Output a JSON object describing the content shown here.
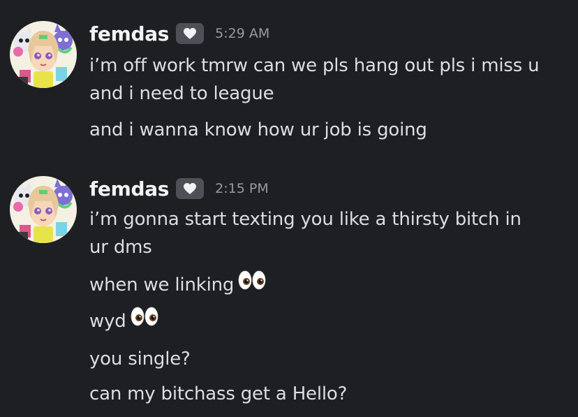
{
  "messages": [
    {
      "username": "femdas",
      "timestamp": "5:29 AM",
      "lines": [
        "i’m off work tmrw can we pls hang out pls i miss u",
        "and i need to league",
        "and i wanna know how ur job is going"
      ]
    },
    {
      "username": "femdas",
      "timestamp": "2:15 PM",
      "lines": [
        "i’m gonna start texting you like a thirsty bitch in",
        "ur dms",
        "when we linking",
        "wyd",
        "you single?",
        "can my bitchass get a Hello?"
      ]
    }
  ],
  "icons": {
    "badge": "heart-badge-icon",
    "emoji": "eyes-emoji-icon"
  }
}
